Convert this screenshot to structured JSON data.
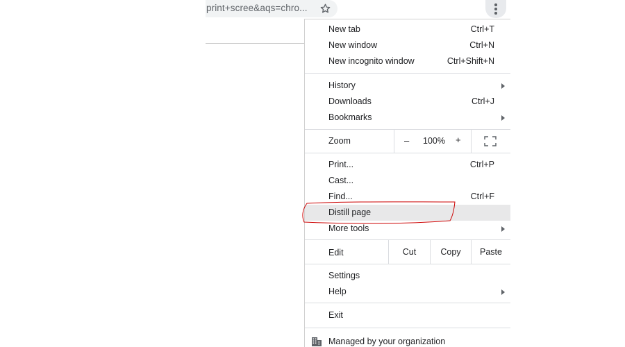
{
  "address_bar": {
    "url_fragment": "print+scree&aqs=chro...",
    "star_icon": "star-outline-icon"
  },
  "toolbar": {
    "menu_icon": "three-dots-vertical-icon"
  },
  "menu": {
    "group1": [
      {
        "label": "New tab",
        "shortcut": "Ctrl+T"
      },
      {
        "label": "New window",
        "shortcut": "Ctrl+N"
      },
      {
        "label": "New incognito window",
        "shortcut": "Ctrl+Shift+N"
      }
    ],
    "group2": [
      {
        "label": "History",
        "shortcut": ""
      },
      {
        "label": "Downloads",
        "shortcut": "Ctrl+J"
      },
      {
        "label": "Bookmarks",
        "shortcut": ""
      }
    ],
    "zoom": {
      "label": "Zoom",
      "minus": "–",
      "value": "100%",
      "plus": "+",
      "fullscreen_icon": "fullscreen-icon"
    },
    "group3": [
      {
        "label": "Print...",
        "shortcut": "Ctrl+P"
      },
      {
        "label": "Cast...",
        "shortcut": ""
      },
      {
        "label": "Find...",
        "shortcut": "Ctrl+F"
      },
      {
        "label": "Distill page",
        "shortcut": ""
      },
      {
        "label": "More tools",
        "shortcut": ""
      }
    ],
    "edit": {
      "label": "Edit",
      "cut": "Cut",
      "copy": "Copy",
      "paste": "Paste"
    },
    "group4": [
      {
        "label": "Settings",
        "shortcut": ""
      },
      {
        "label": "Help",
        "shortcut": ""
      }
    ],
    "exit": {
      "label": "Exit"
    },
    "managed": {
      "label": "Managed by your organization",
      "icon": "building-icon"
    }
  },
  "colors": {
    "annotation": "#cc0000",
    "highlight": "#e8e8e9"
  }
}
